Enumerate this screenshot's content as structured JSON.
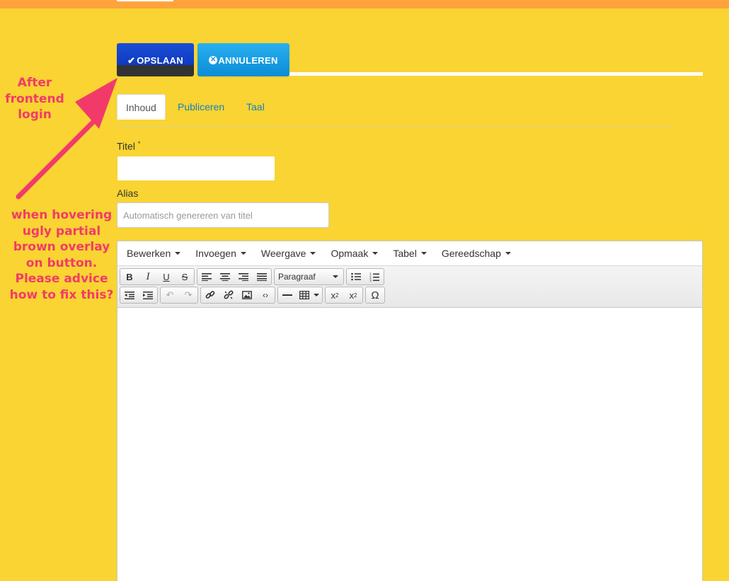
{
  "toolbar": {
    "save_label": "OPSLAAN",
    "cancel_label": "ANNULEREN"
  },
  "tabs": [
    {
      "label": "Inhoud"
    },
    {
      "label": "Publiceren"
    },
    {
      "label": "Taal"
    }
  ],
  "form": {
    "title_label": "Titel",
    "title_required": "*",
    "title_value": "",
    "alias_label": "Alias",
    "alias_placeholder": "Automatisch genereren van titel"
  },
  "editor": {
    "menu": [
      "Bewerken",
      "Invoegen",
      "Weergave",
      "Opmaak",
      "Tabel",
      "Gereedschap"
    ],
    "block_format": "Paragraaf"
  },
  "annotation": {
    "top_text": "After frontend login",
    "bottom_text": "when hovering ugly partial brown overlay on button. Please advice how to fix this?",
    "color": "#f23a6a"
  },
  "colors": {
    "page_bg": "#f9d432",
    "top_bar": "#ffa23c",
    "save_button": "#1a4fd6",
    "cancel_button": "#1c9be0",
    "link": "#1a7fc0"
  }
}
